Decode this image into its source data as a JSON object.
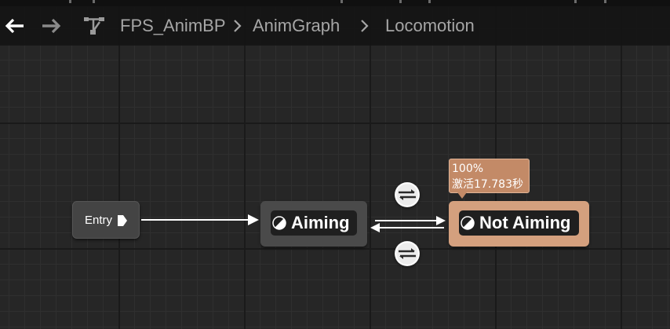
{
  "toolbar": {
    "back_icon": "arrow-left-icon",
    "forward_icon": "arrow-right-icon",
    "hierarchy_icon": "hierarchy-icon",
    "breadcrumbs": [
      "FPS_AnimBP",
      "AnimGraph",
      "Locomotion"
    ]
  },
  "graph": {
    "entry": {
      "label": "Entry"
    },
    "states": [
      {
        "label": "Aiming",
        "active": false
      },
      {
        "label": "Not Aiming",
        "active": true
      }
    ],
    "active_tooltip": {
      "weight": "100%",
      "active_time": "激活17.783秒"
    },
    "transitions": [
      {
        "from": "Aiming",
        "to": "Not Aiming",
        "icon": "transition-rule-icon"
      },
      {
        "from": "Not Aiming",
        "to": "Aiming",
        "icon": "transition-rule-icon"
      }
    ]
  },
  "colors": {
    "background": "#262626",
    "active_state": "#d4a07e",
    "inactive_state": "#4a4a4a",
    "tooltip": "#c38a67"
  }
}
